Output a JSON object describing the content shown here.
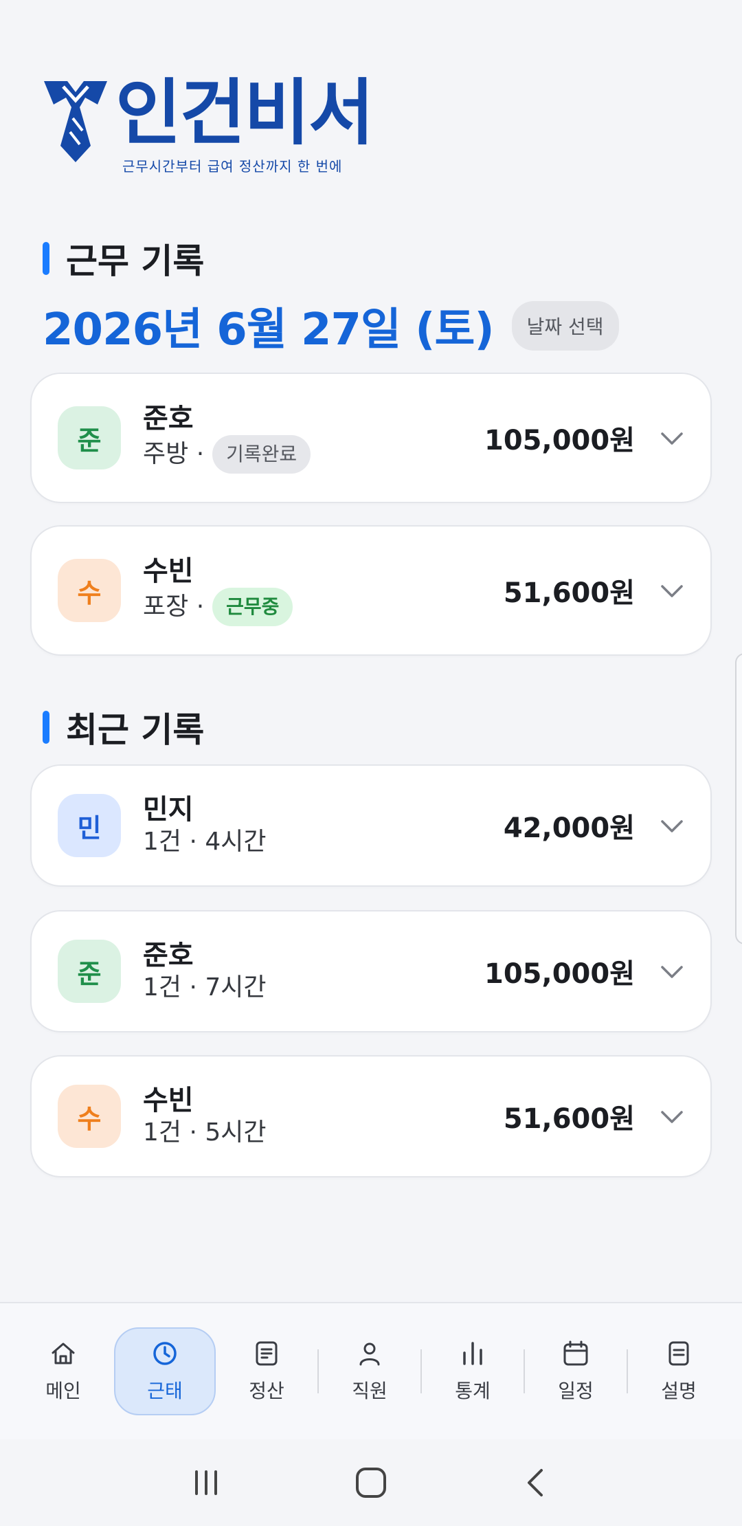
{
  "app": {
    "logo_name": "인건비서",
    "logo_tagline": "근무시간부터 급여 정산까지 한 번에",
    "brand_color": "#1549a8",
    "accent_color": "#1565d8"
  },
  "work_section": {
    "title": "근무 기록",
    "date": "2026년 6월 27일 (토)",
    "date_button": "날짜 선택",
    "records": [
      {
        "initial": "준",
        "name": "준호",
        "dept": "주방",
        "status": "기록완료",
        "amount": "105,000원"
      },
      {
        "initial": "수",
        "name": "수빈",
        "dept": "포장",
        "status": "근무중",
        "amount": "51,600원"
      }
    ]
  },
  "recent_section": {
    "title": "최근 기록",
    "records": [
      {
        "initial": "민",
        "name": "민지",
        "summary": "1건 · 4시간",
        "amount": "42,000원"
      },
      {
        "initial": "준",
        "name": "준호",
        "summary": "1건 · 7시간",
        "amount": "105,000원"
      },
      {
        "initial": "수",
        "name": "수빈",
        "summary": "1건 · 5시간",
        "amount": "51,600원"
      }
    ]
  },
  "nav": {
    "items": [
      {
        "label": "메인",
        "icon": "home-icon"
      },
      {
        "label": "근태",
        "icon": "clock-icon",
        "active": true
      },
      {
        "label": "정산",
        "icon": "receipt-icon"
      },
      {
        "label": "직원",
        "icon": "person-icon"
      },
      {
        "label": "통계",
        "icon": "bar-chart-icon"
      },
      {
        "label": "일정",
        "icon": "calendar-icon"
      },
      {
        "label": "설명",
        "icon": "document-icon"
      }
    ]
  },
  "system_bar": {
    "buttons": [
      "recent-apps-icon",
      "home-button-icon",
      "back-icon"
    ]
  }
}
